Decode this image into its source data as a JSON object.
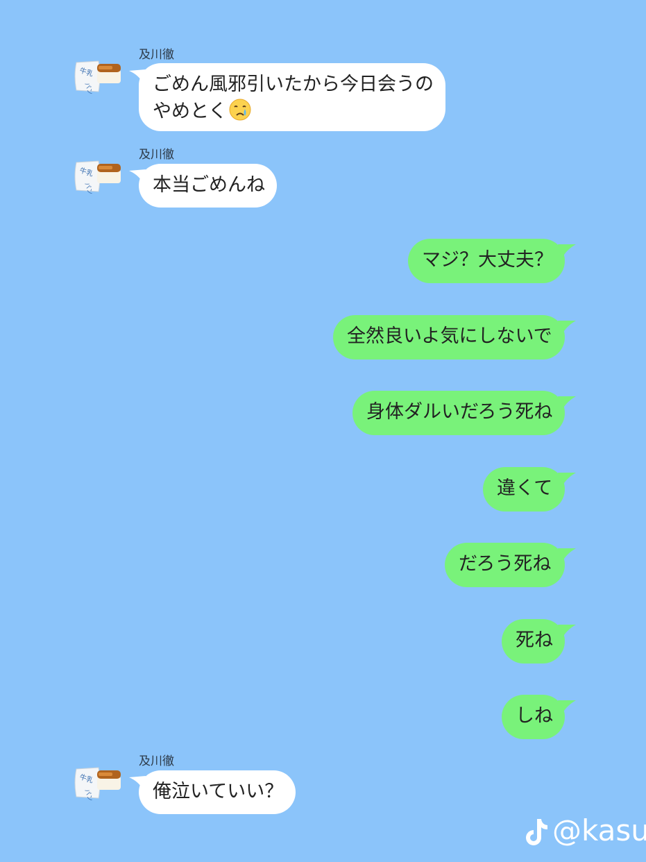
{
  "chat": {
    "incoming_sender": "及川徹",
    "avatar_icon": "milk-bread-stamp-icon",
    "avatar_text": "牛乳パン",
    "messages": [
      {
        "side": "in",
        "sender": "及川徹",
        "lines": [
          "ごめん風邪引いたから今日会うの",
          "やめとく"
        ],
        "emoji": "crying-face-icon"
      },
      {
        "side": "in",
        "sender": "及川徹",
        "lines": [
          "本当ごめんね"
        ]
      },
      {
        "side": "out",
        "lines": [
          "マジ？大丈夫？"
        ]
      },
      {
        "side": "out",
        "lines": [
          "全然良いよ気にしないで"
        ]
      },
      {
        "side": "out",
        "lines": [
          "身体ダルいだろう死ね"
        ]
      },
      {
        "side": "out",
        "lines": [
          "違くて"
        ]
      },
      {
        "side": "out",
        "lines": [
          "だろう死ね"
        ]
      },
      {
        "side": "out",
        "lines": [
          "死ね"
        ]
      },
      {
        "side": "out",
        "lines": [
          "しね"
        ]
      },
      {
        "side": "in",
        "sender": "及川徹",
        "lines": [
          "俺泣いていい？"
        ]
      }
    ]
  },
  "watermark": {
    "icon": "tiktok-icon",
    "text": "@kasu_"
  },
  "colors": {
    "background": "#8bc4fa",
    "incoming_bubble": "#ffffff",
    "outgoing_bubble": "#79f27a"
  }
}
